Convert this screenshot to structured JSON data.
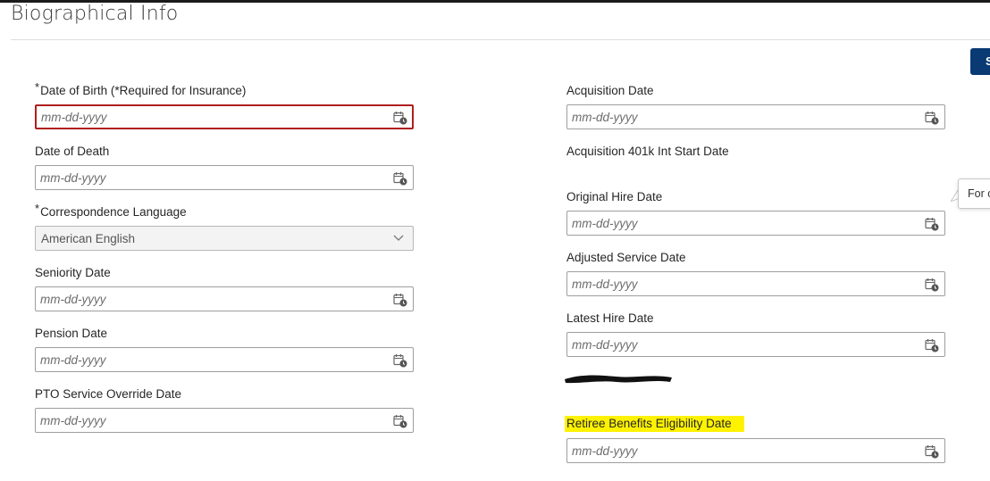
{
  "page": {
    "title": "Biographical Info"
  },
  "actions": {
    "save_label": "S"
  },
  "tooltip": {
    "text": "For c"
  },
  "left_fields": [
    {
      "label": "Date of Birth (*Required for Insurance)",
      "required": true,
      "placeholder": "mm-dd-yyyy",
      "error": true
    },
    {
      "label": "Date of Death",
      "placeholder": "mm-dd-yyyy"
    },
    {
      "label": "Correspondence Language",
      "required": true,
      "type": "select",
      "value": "American English"
    },
    {
      "label": "Seniority Date",
      "placeholder": "mm-dd-yyyy"
    },
    {
      "label": "Pension Date",
      "placeholder": "mm-dd-yyyy"
    },
    {
      "label": "PTO Service Override Date",
      "placeholder": "mm-dd-yyyy"
    }
  ],
  "right_fields": [
    {
      "label": "Acquisition Date",
      "placeholder": "mm-dd-yyyy"
    },
    {
      "label": "Acquisition 401k Int Start Date"
    },
    {
      "label": "Original Hire Date",
      "placeholder": "mm-dd-yyyy"
    },
    {
      "label": "Adjusted Service Date",
      "placeholder": "mm-dd-yyyy"
    },
    {
      "label": "Latest Hire Date",
      "placeholder": "mm-dd-yyyy"
    },
    {
      "label": "Retiree Benefits Eligibility Date",
      "placeholder": "mm-dd-yyyy",
      "highlighted": true
    }
  ],
  "colors": {
    "error_border": "#b01e1e",
    "primary_button": "#0a3a73",
    "highlight": "#fff200"
  },
  "icons": {
    "date_picker": "calendar-clock-icon",
    "dropdown": "chevron-down-icon"
  }
}
